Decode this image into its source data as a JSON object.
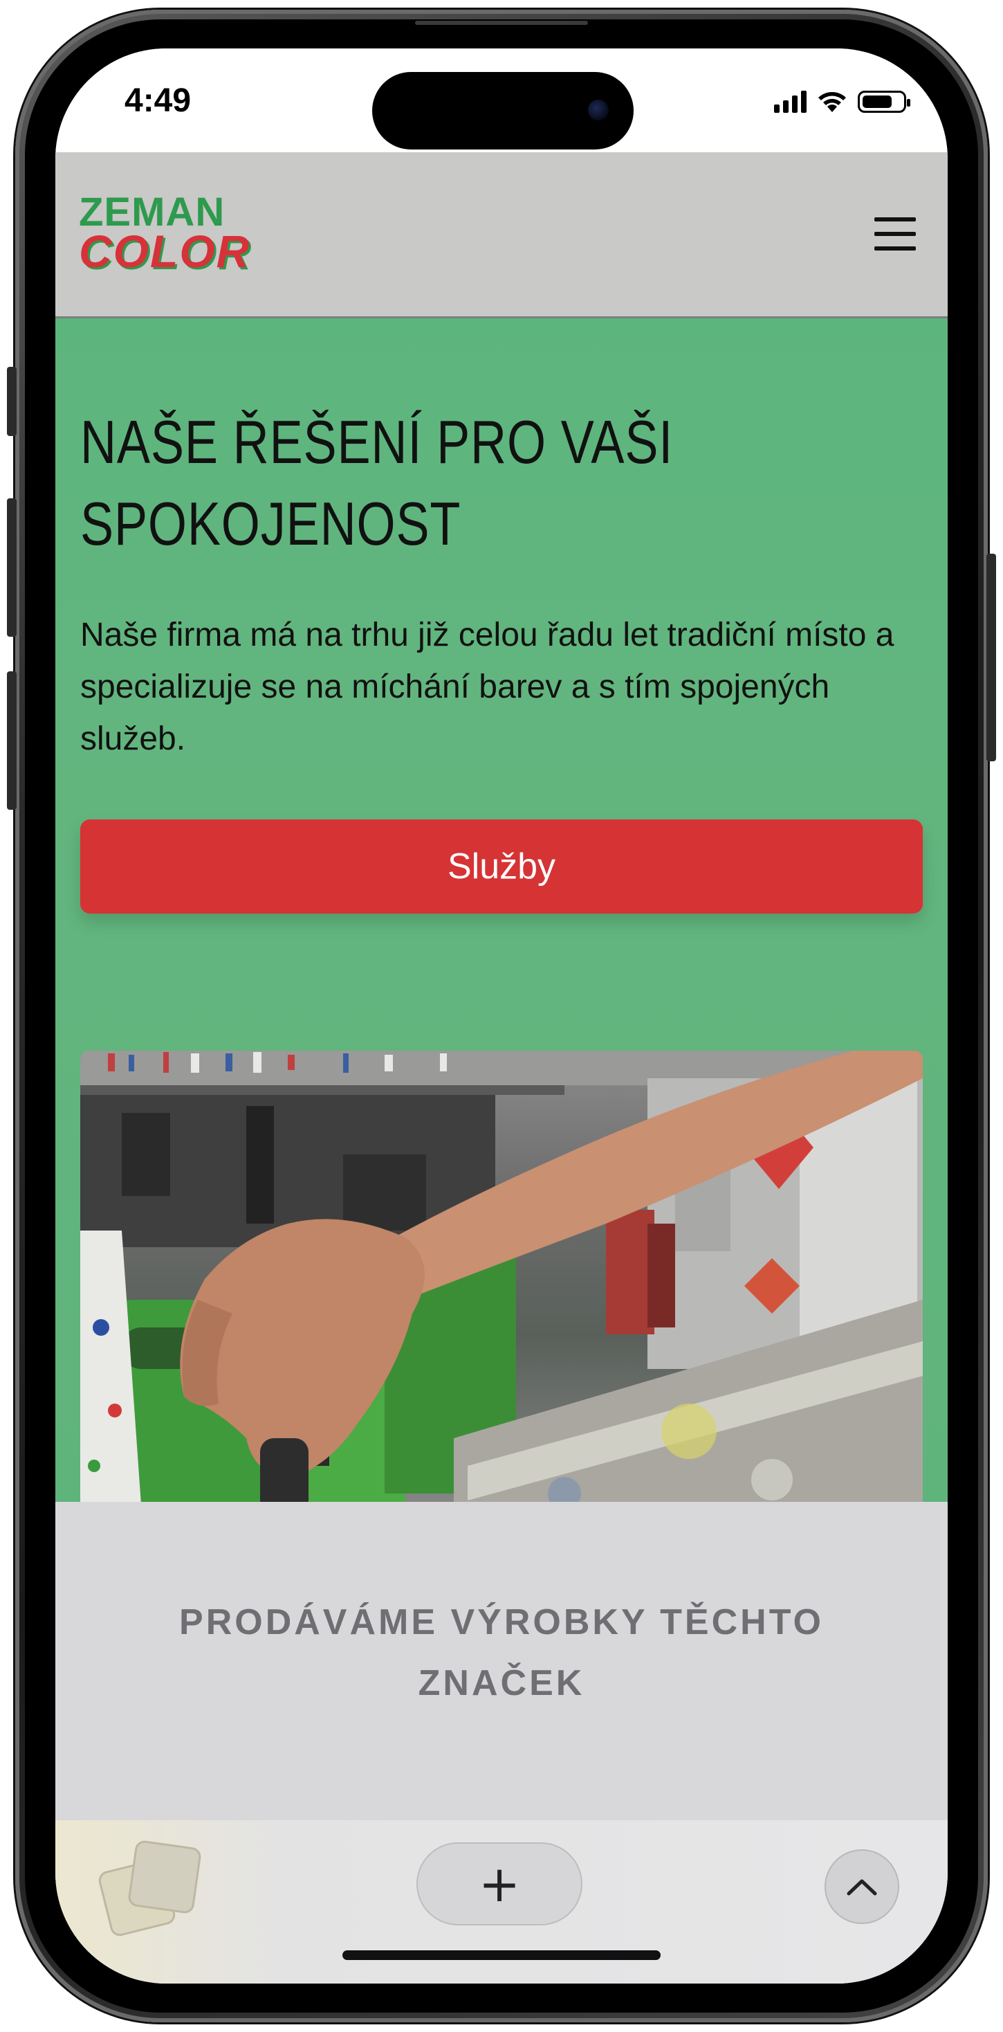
{
  "status_bar": {
    "time": "4:49"
  },
  "header": {
    "logo_top": "ZEMAN",
    "logo_bottom": "COLOR",
    "menu_icon": "hamburger-menu-icon"
  },
  "hero": {
    "title": "NAŠE ŘEŠENÍ PRO VAŠI SPOKOJENOST",
    "text": "Naše firma má na trhu již celou řadu let tradiční místo a specializuje se na míchání barev a s tím spojených služeb.",
    "button_label": "Služby",
    "image": "paint-store-photo"
  },
  "brands": {
    "title": "PRODÁVÁME VÝROBKY TĚCHTO ZNAČEK"
  },
  "browser_bar": {
    "tabs_icon": "tabs-overview-icon",
    "new_tab_label": "+",
    "scroll_up_icon": "chevron-up-icon"
  },
  "colors": {
    "hero_bg": "#5fb47c",
    "button": "#d63335",
    "header_bg": "#c9c9c7",
    "brand_green": "#2e9a4e",
    "brand_red": "#d6323a",
    "brands_bg": "#d8d8db"
  }
}
